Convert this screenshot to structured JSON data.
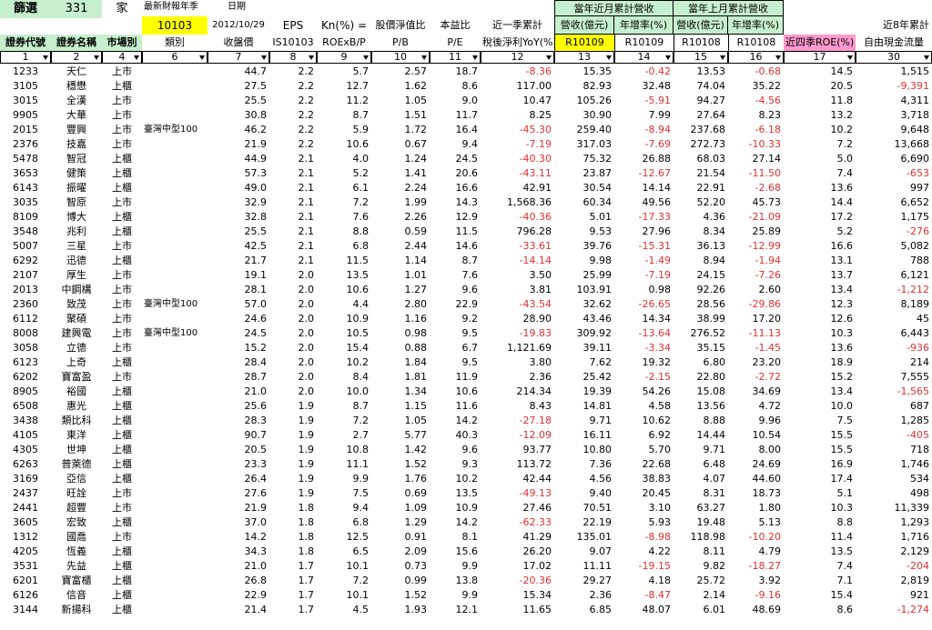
{
  "filter": {
    "label": "篩選",
    "count": "331",
    "unit": "家"
  },
  "top": {
    "latest_label": "最新財報年季",
    "latest_value": "10103",
    "date_label": "日期",
    "date_value": "2012/10/29",
    "eps": "EPS",
    "kn": "Kn(%) =",
    "pb_label": "股價淨值比",
    "pe_label": "本益比",
    "qtr_label": "近一季累計",
    "month_rev_label": "當年近月累計營收",
    "prev_rev_label": "當年上月累計營收",
    "cash_label": "近8年累計"
  },
  "headers": [
    "證券代號",
    "證券名稱",
    "市場別",
    "類別",
    "收盤價",
    "IS10103",
    "ROExB/P",
    "P/B",
    "P/E",
    "稅後淨利YoY(%)",
    "R10109",
    "R10109",
    "R10108",
    "R10108",
    "近四季ROE(%)",
    "自由現金流量"
  ],
  "subheaders": {
    "rev1": "營收(億元)",
    "grow1": "年增率(%)",
    "rev2": "營收(億元)",
    "grow2": "年增率(%)"
  },
  "colnums": [
    "1",
    "2",
    "4",
    "6",
    "7",
    "8",
    "9",
    "10",
    "11",
    "12",
    "13",
    "14",
    "15",
    "16",
    "17",
    "30"
  ],
  "colors": {
    "yellow": "#ffff00",
    "green": "#c6efce",
    "pink": "#ff99cc",
    "negative": "#e03030"
  },
  "rows": [
    [
      "1233",
      "天仁",
      "上市",
      "",
      "44.7",
      "2.2",
      "5.7",
      "2.57",
      "18.7",
      "-8.36",
      "15.35",
      "-0.42",
      "13.53",
      "-0.68",
      "14.5",
      "1,515"
    ],
    [
      "3105",
      "穩懋",
      "上櫃",
      "",
      "27.5",
      "2.2",
      "12.7",
      "1.62",
      "8.6",
      "117.00",
      "82.93",
      "32.48",
      "74.04",
      "35.22",
      "20.5",
      "-9,391"
    ],
    [
      "3015",
      "全漢",
      "上市",
      "",
      "25.5",
      "2.2",
      "11.2",
      "1.05",
      "9.0",
      "10.47",
      "105.26",
      "-5.91",
      "94.27",
      "-4.56",
      "11.8",
      "4,311"
    ],
    [
      "9905",
      "大華",
      "上市",
      "",
      "30.8",
      "2.2",
      "8.7",
      "1.51",
      "11.7",
      "8.25",
      "30.90",
      "7.99",
      "27.64",
      "8.23",
      "13.2",
      "3,718"
    ],
    [
      "2015",
      "豐興",
      "上市",
      "臺灣中型100",
      "46.2",
      "2.2",
      "5.9",
      "1.72",
      "16.4",
      "-45.30",
      "259.40",
      "-8.94",
      "237.68",
      "-6.18",
      "10.2",
      "9,648"
    ],
    [
      "2376",
      "技嘉",
      "上市",
      "",
      "21.9",
      "2.2",
      "10.6",
      "0.67",
      "9.4",
      "-7.19",
      "317.03",
      "-7.69",
      "272.73",
      "-10.33",
      "7.2",
      "13,668"
    ],
    [
      "5478",
      "智冠",
      "上櫃",
      "",
      "44.9",
      "2.1",
      "4.0",
      "1.24",
      "24.5",
      "-40.30",
      "75.32",
      "26.88",
      "68.03",
      "27.14",
      "5.0",
      "6,690"
    ],
    [
      "3653",
      "健策",
      "上櫃",
      "",
      "57.3",
      "2.1",
      "5.2",
      "1.41",
      "20.6",
      "-43.11",
      "23.87",
      "-12.67",
      "21.54",
      "-11.50",
      "7.4",
      "-653"
    ],
    [
      "6143",
      "振曜",
      "上櫃",
      "",
      "49.0",
      "2.1",
      "6.1",
      "2.24",
      "16.6",
      "42.91",
      "30.54",
      "14.14",
      "22.91",
      "-2.68",
      "13.6",
      "997"
    ],
    [
      "3035",
      "智原",
      "上市",
      "",
      "32.9",
      "2.1",
      "7.2",
      "1.99",
      "14.3",
      "1,568.36",
      "60.34",
      "49.56",
      "52.20",
      "45.73",
      "14.4",
      "6,652"
    ],
    [
      "8109",
      "博大",
      "上櫃",
      "",
      "32.8",
      "2.1",
      "7.6",
      "2.26",
      "12.9",
      "-40.36",
      "5.01",
      "-17.33",
      "4.36",
      "-21.09",
      "17.2",
      "1,175"
    ],
    [
      "3548",
      "兆利",
      "上櫃",
      "",
      "25.5",
      "2.1",
      "8.8",
      "0.59",
      "11.5",
      "796.28",
      "9.53",
      "27.96",
      "8.34",
      "25.89",
      "5.2",
      "-276"
    ],
    [
      "5007",
      "三星",
      "上市",
      "",
      "42.5",
      "2.1",
      "6.8",
      "2.44",
      "14.6",
      "-33.61",
      "39.76",
      "-15.31",
      "36.13",
      "-12.99",
      "16.6",
      "5,082"
    ],
    [
      "6292",
      "迅德",
      "上櫃",
      "",
      "21.7",
      "2.1",
      "11.5",
      "1.14",
      "8.7",
      "-14.14",
      "9.98",
      "-1.49",
      "8.94",
      "-1.94",
      "13.1",
      "788"
    ],
    [
      "2107",
      "厚生",
      "上市",
      "",
      "19.1",
      "2.0",
      "13.5",
      "1.01",
      "7.6",
      "3.50",
      "25.99",
      "-7.19",
      "24.15",
      "-7.26",
      "13.7",
      "6,121"
    ],
    [
      "2013",
      "中鋼構",
      "上市",
      "",
      "28.1",
      "2.0",
      "10.6",
      "1.27",
      "9.6",
      "3.81",
      "103.91",
      "0.98",
      "92.26",
      "2.60",
      "13.4",
      "-1,212"
    ],
    [
      "2360",
      "致茂",
      "上市",
      "臺灣中型100",
      "57.0",
      "2.0",
      "4.4",
      "2.80",
      "22.9",
      "-43.54",
      "32.62",
      "-26.65",
      "28.56",
      "-29.86",
      "12.3",
      "8,189"
    ],
    [
      "6112",
      "聚碩",
      "上市",
      "",
      "24.6",
      "2.0",
      "10.9",
      "1.16",
      "9.2",
      "28.90",
      "43.46",
      "14.34",
      "38.99",
      "17.20",
      "12.6",
      "45"
    ],
    [
      "8008",
      "建興電",
      "上市",
      "臺灣中型100",
      "24.5",
      "2.0",
      "10.5",
      "0.98",
      "9.5",
      "-19.83",
      "309.92",
      "-13.64",
      "276.52",
      "-11.13",
      "10.3",
      "6,443"
    ],
    [
      "3058",
      "立德",
      "上市",
      "",
      "15.2",
      "2.0",
      "15.4",
      "0.88",
      "6.7",
      "1,121.69",
      "39.11",
      "-3.34",
      "35.15",
      "-1.45",
      "13.6",
      "-936"
    ],
    [
      "6123",
      "上奇",
      "上櫃",
      "",
      "28.4",
      "2.0",
      "10.2",
      "1.84",
      "9.5",
      "3.80",
      "7.62",
      "19.32",
      "6.80",
      "23.20",
      "18.9",
      "214"
    ],
    [
      "6202",
      "寶富盈",
      "上市",
      "",
      "28.7",
      "2.0",
      "8.4",
      "1.81",
      "11.9",
      "2.36",
      "25.42",
      "-2.15",
      "22.80",
      "-2.72",
      "15.2",
      "7,555"
    ],
    [
      "8905",
      "裕國",
      "上櫃",
      "",
      "21.0",
      "2.0",
      "10.0",
      "1.34",
      "10.6",
      "214.34",
      "19.39",
      "54.26",
      "15.08",
      "34.69",
      "13.4",
      "-1,565"
    ],
    [
      "6508",
      "惠光",
      "上櫃",
      "",
      "25.6",
      "1.9",
      "8.7",
      "1.15",
      "11.6",
      "8.43",
      "14.81",
      "4.58",
      "13.56",
      "4.72",
      "10.0",
      "687"
    ],
    [
      "3438",
      "類比科",
      "上櫃",
      "",
      "28.3",
      "1.9",
      "7.2",
      "1.05",
      "14.2",
      "-27.18",
      "9.71",
      "10.62",
      "8.88",
      "9.96",
      "7.5",
      "1,285"
    ],
    [
      "4105",
      "東洋",
      "上櫃",
      "",
      "90.7",
      "1.9",
      "2.7",
      "5.77",
      "40.3",
      "-12.09",
      "16.11",
      "6.92",
      "14.44",
      "10.54",
      "15.5",
      "-405"
    ],
    [
      "4305",
      "世坤",
      "上櫃",
      "",
      "20.5",
      "1.9",
      "10.8",
      "1.42",
      "9.6",
      "93.77",
      "10.80",
      "5.70",
      "9.71",
      "8.00",
      "15.5",
      "718"
    ],
    [
      "6263",
      "普萊德",
      "上櫃",
      "",
      "23.3",
      "1.9",
      "11.1",
      "1.52",
      "9.3",
      "113.72",
      "7.36",
      "22.68",
      "6.48",
      "24.69",
      "16.9",
      "1,746"
    ],
    [
      "3169",
      "亞信",
      "上櫃",
      "",
      "26.4",
      "1.9",
      "9.9",
      "1.76",
      "10.2",
      "42.44",
      "4.56",
      "38.83",
      "4.07",
      "44.60",
      "17.4",
      "534"
    ],
    [
      "2437",
      "旺詮",
      "上市",
      "",
      "27.6",
      "1.9",
      "7.5",
      "0.69",
      "13.5",
      "-49.13",
      "9.40",
      "20.45",
      "8.31",
      "18.73",
      "5.1",
      "498"
    ],
    [
      "2441",
      "超豐",
      "上市",
      "",
      "21.9",
      "1.8",
      "9.4",
      "1.09",
      "10.9",
      "27.46",
      "70.51",
      "3.10",
      "63.27",
      "1.80",
      "10.3",
      "11,339"
    ],
    [
      "3605",
      "宏致",
      "上櫃",
      "",
      "37.0",
      "1.8",
      "6.8",
      "1.29",
      "14.2",
      "-62.33",
      "22.19",
      "5.93",
      "19.48",
      "5.13",
      "8.8",
      "1,293"
    ],
    [
      "1312",
      "國喬",
      "上市",
      "",
      "14.2",
      "1.8",
      "12.5",
      "0.91",
      "8.1",
      "41.29",
      "135.01",
      "-8.98",
      "118.98",
      "-10.20",
      "11.4",
      "1,716"
    ],
    [
      "4205",
      "恆義",
      "上櫃",
      "",
      "34.3",
      "1.8",
      "6.5",
      "2.09",
      "15.6",
      "26.20",
      "9.07",
      "4.22",
      "8.11",
      "4.79",
      "13.5",
      "2,129"
    ],
    [
      "3531",
      "先益",
      "上櫃",
      "",
      "21.0",
      "1.7",
      "10.1",
      "0.73",
      "9.9",
      "17.02",
      "11.11",
      "-19.15",
      "9.82",
      "-18.27",
      "7.4",
      "-204"
    ],
    [
      "6201",
      "寶富櫃",
      "上櫃",
      "",
      "26.8",
      "1.7",
      "7.2",
      "0.99",
      "13.8",
      "-20.36",
      "29.27",
      "4.18",
      "25.72",
      "3.92",
      "7.1",
      "2,819"
    ],
    [
      "6126",
      "信音",
      "上櫃",
      "",
      "22.9",
      "1.7",
      "10.1",
      "1.52",
      "9.9",
      "15.34",
      "2.36",
      "-8.47",
      "2.14",
      "-9.16",
      "15.4",
      "921"
    ],
    [
      "3144",
      "新揚科",
      "上櫃",
      "",
      "21.4",
      "1.7",
      "4.5",
      "1.93",
      "12.1",
      "11.65",
      "6.85",
      "48.07",
      "6.01",
      "48.69",
      "8.6",
      "-1,274"
    ]
  ]
}
